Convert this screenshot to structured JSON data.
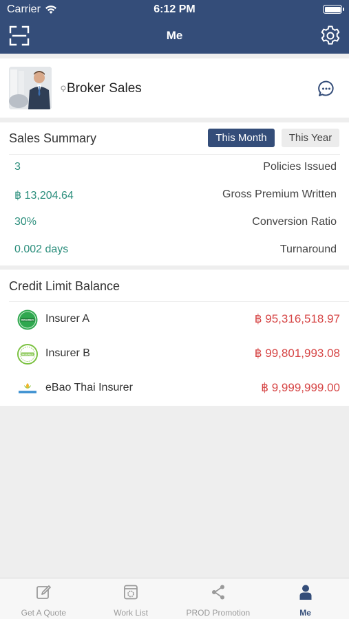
{
  "status_bar": {
    "carrier": "Carrier",
    "time": "6:12 PM"
  },
  "nav": {
    "title": "Me",
    "left_icon": "scan-icon",
    "right_icon": "gear-icon"
  },
  "profile": {
    "name": "Broker Sales",
    "action_icon": "chat-icon"
  },
  "sales_summary": {
    "title": "Sales Summary",
    "segments": [
      "This Month",
      "This Year"
    ],
    "selected_segment": "This Month",
    "stats": [
      {
        "value": "3",
        "label": "Policies Issued"
      },
      {
        "value": "฿ 13,204.64",
        "label": "Gross Premium Written"
      },
      {
        "value": "30%",
        "label": "Conversion Ratio"
      },
      {
        "value": "0.002 days",
        "label": "Turnaround"
      }
    ]
  },
  "credit_limit": {
    "title": "Credit Limit Balance",
    "insurers": [
      {
        "name": "Insurer A",
        "amount": "฿ 95,316,518.97",
        "logo": "insured-badge-green"
      },
      {
        "name": "Insurer B",
        "amount": "฿ 99,801,993.08",
        "logo": "insured-badge-outline"
      },
      {
        "name": "eBao Thai Insurer",
        "amount": "฿ 9,999,999.00",
        "logo": "ebao-thai-logo"
      }
    ]
  },
  "tabbar": {
    "tabs": [
      {
        "label": "Get A Quote",
        "icon": "edit-icon"
      },
      {
        "label": "Work List",
        "icon": "worklist-icon"
      },
      {
        "label": "PROD Promotion",
        "icon": "share-icon"
      },
      {
        "label": "Me",
        "icon": "person-icon"
      }
    ],
    "active_index": 3
  },
  "colors": {
    "brand": "#344d79",
    "value_green": "#2b8e7c",
    "amount_red": "#d64545"
  }
}
